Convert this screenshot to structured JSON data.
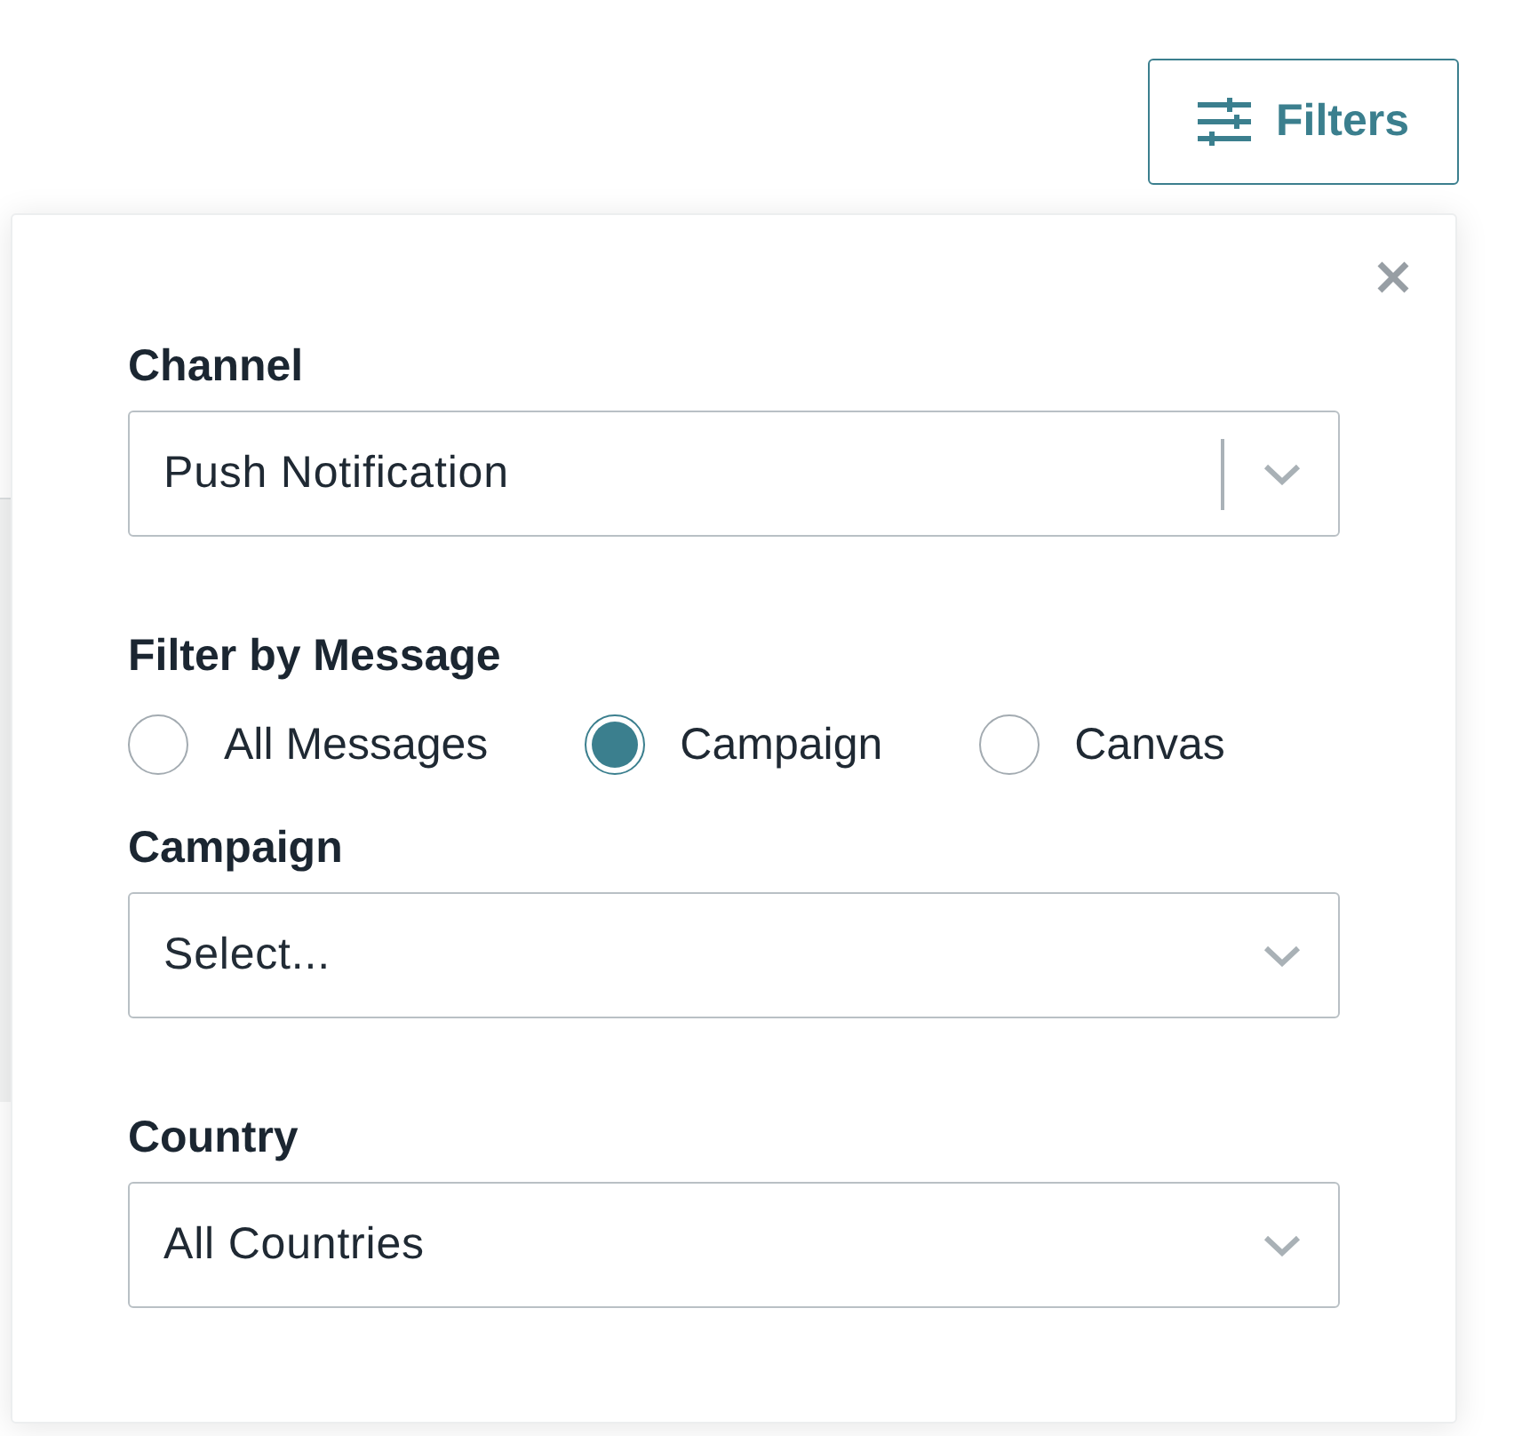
{
  "filters_button": {
    "label": "Filters"
  },
  "filter_panel": {
    "fields": [
      {
        "kind": "select",
        "label": "Channel",
        "value": "Push Notification",
        "separator": true
      },
      {
        "kind": "radio",
        "label": "Filter by Message",
        "options": [
          {
            "label": "All Messages",
            "selected": false
          },
          {
            "label": "Campaign",
            "selected": true
          },
          {
            "label": "Canvas",
            "selected": false
          }
        ]
      },
      {
        "kind": "select",
        "label": "Campaign",
        "placeholder": "Select...",
        "separator": false
      },
      {
        "kind": "select",
        "label": "Country",
        "value": "All Countries",
        "separator": false
      }
    ]
  }
}
